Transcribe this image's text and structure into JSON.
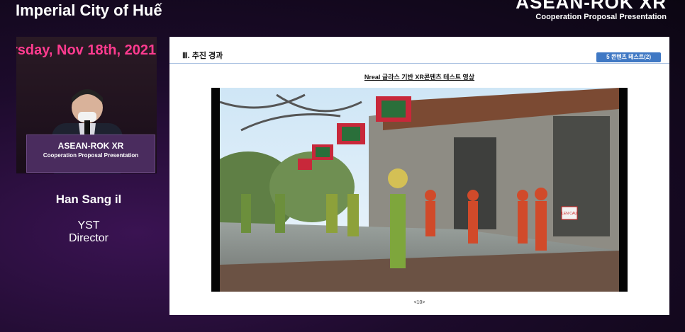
{
  "header": {
    "title": "Imperial City of Huế",
    "brand_big": "ASEAN-ROK XR",
    "brand_small": "Cooperation Proposal Presentation"
  },
  "speaker_video": {
    "stage_text": "rsday, Nov 18th, 2021",
    "podium_title": "ASEAN-ROK XR",
    "podium_subtitle": "Cooperation Proposal Presentation"
  },
  "speaker": {
    "name": "Han Sang il",
    "org": "YST",
    "role": "Director"
  },
  "slide": {
    "section": "Ⅲ. 추진 경과",
    "tag": "5 콘텐츠 테스트(2)",
    "caption": "Nreal 글라스 기반 XR콘텐츠 테스트 영상",
    "page_number": "<10>",
    "sign_text": "LEN CAU"
  },
  "colors": {
    "background": "#1d0b2c",
    "accent_pink": "#ff3b8f",
    "tag_blue": "#3f78c4",
    "podium_purple": "#4a2c5e"
  }
}
